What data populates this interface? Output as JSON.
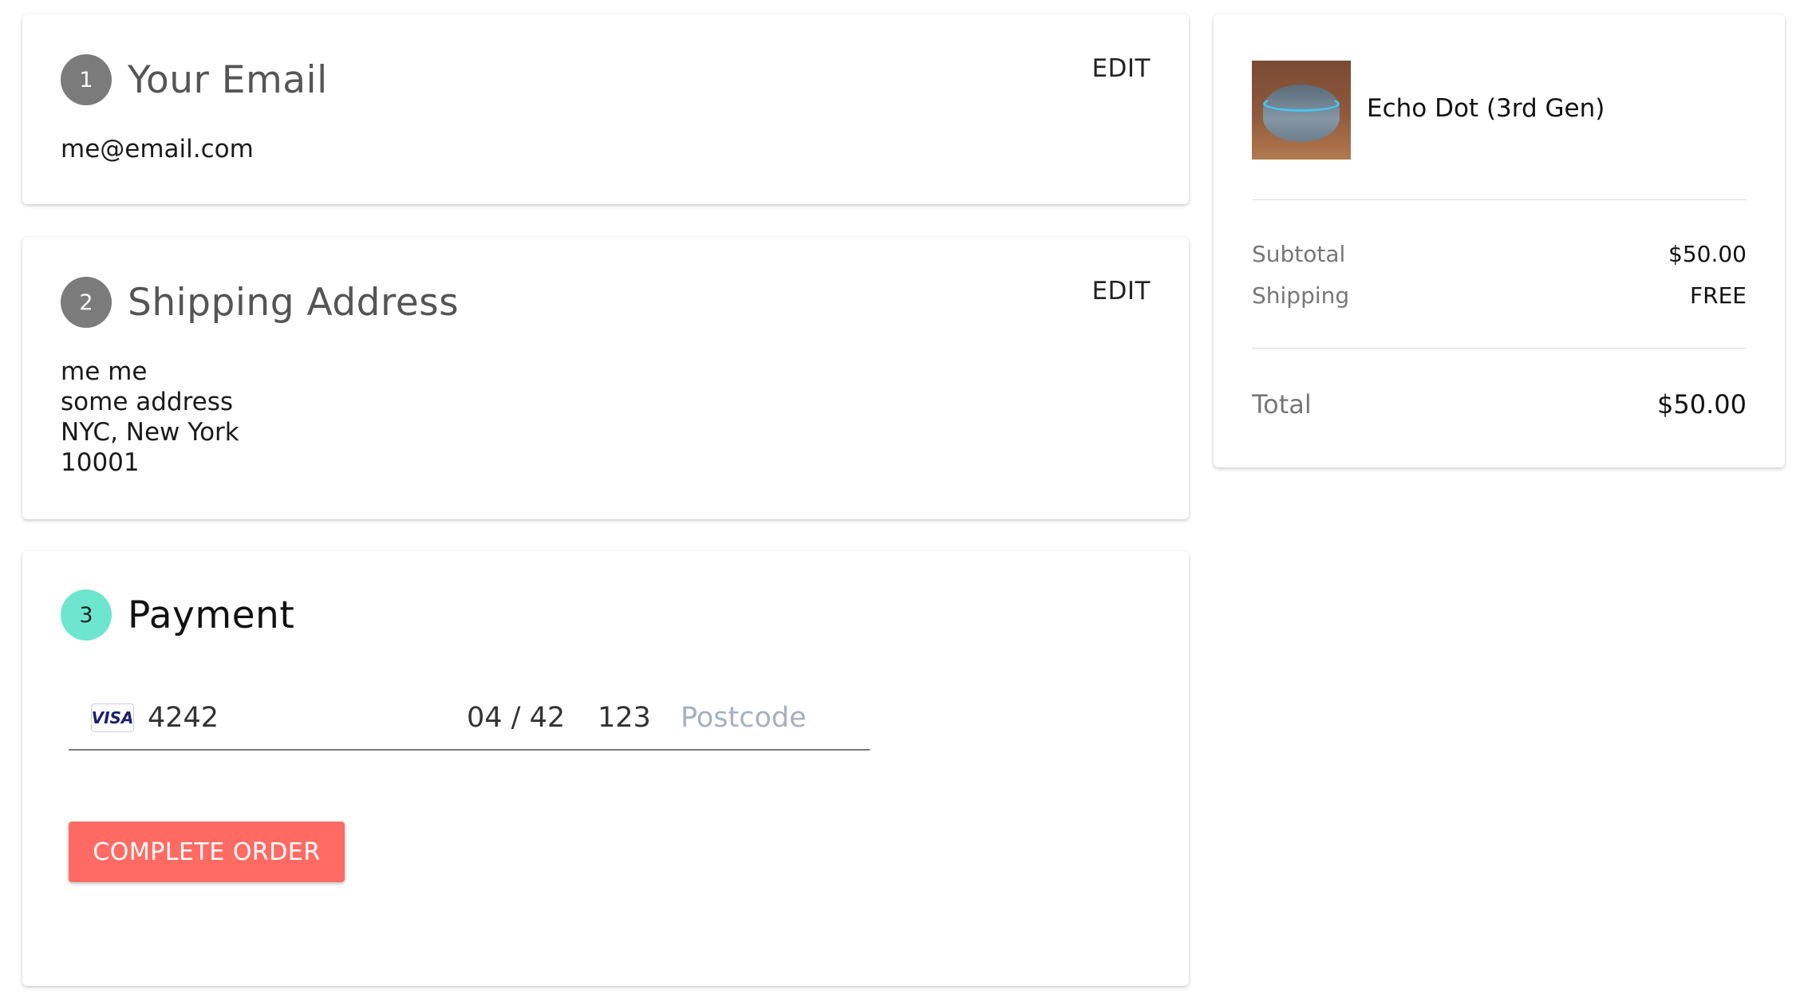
{
  "steps": {
    "email": {
      "number": "1",
      "title": "Your Email",
      "edit_label": "EDIT",
      "value": "me@email.com"
    },
    "shipping": {
      "number": "2",
      "title": "Shipping Address",
      "edit_label": "EDIT",
      "lines": [
        "me me",
        "some address",
        "NYC, New York",
        "10001"
      ]
    },
    "payment": {
      "number": "3",
      "title": "Payment",
      "card_brand": "VISA",
      "card_number": "4242",
      "expiry": "04 / 42",
      "cvc": "123",
      "postcode_placeholder": "Postcode",
      "submit_label": "COMPLETE ORDER"
    }
  },
  "summary": {
    "product": {
      "name": "Echo Dot (3rd Gen)",
      "image_icon": "echo-dot-image"
    },
    "subtotal_label": "Subtotal",
    "subtotal_value": "$50.00",
    "shipping_label": "Shipping",
    "shipping_value": "FREE",
    "total_label": "Total",
    "total_value": "$50.00"
  },
  "colors": {
    "active_step": "#6ee6cf",
    "inactive_step": "#7b7b7b",
    "button": "#ff6b63",
    "placeholder": "#a3b1c2"
  }
}
